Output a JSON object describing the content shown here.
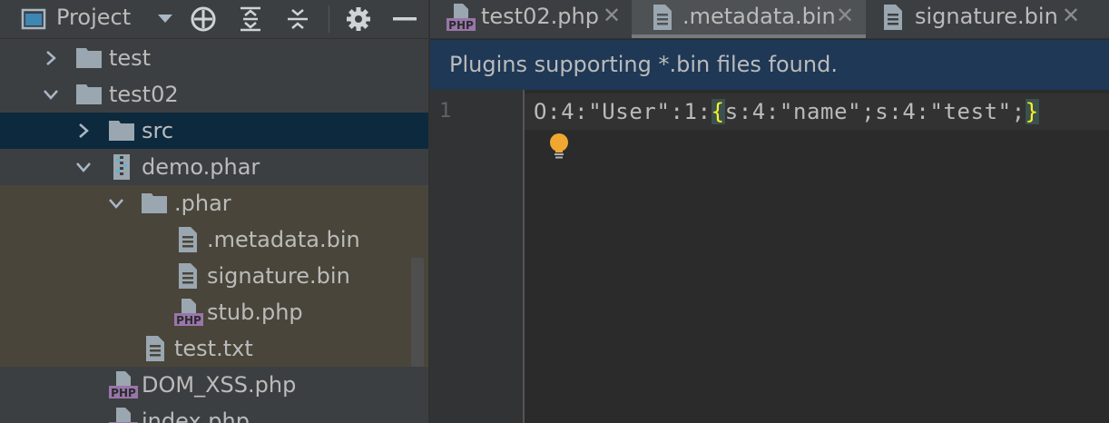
{
  "project_panel": {
    "title": "Project",
    "icons": [
      "window-icon",
      "dropdown-icon",
      "locate-icon",
      "expand-all-icon",
      "collapse-all-icon",
      "settings-icon",
      "minimize-icon"
    ],
    "tree": [
      {
        "label": "test",
        "type": "folder",
        "expanded": false
      },
      {
        "label": "test02",
        "type": "folder",
        "expanded": true
      },
      {
        "label": "src",
        "type": "folder",
        "expanded": false,
        "selected": true
      },
      {
        "label": "demo.phar",
        "type": "archive",
        "expanded": true
      },
      {
        "label": ".phar",
        "type": "folder",
        "expanded": true
      },
      {
        "label": ".metadata.bin",
        "type": "file"
      },
      {
        "label": "signature.bin",
        "type": "file"
      },
      {
        "label": "stub.php",
        "type": "php"
      },
      {
        "label": "test.txt",
        "type": "file"
      },
      {
        "label": "DOM_XSS.php",
        "type": "php"
      },
      {
        "label": "index.php",
        "type": "php"
      }
    ]
  },
  "editor": {
    "tabs": [
      {
        "label": "test02.php",
        "icon": "php-file-icon",
        "active": false
      },
      {
        "label": ".metadata.bin",
        "icon": "text-file-icon",
        "active": true
      },
      {
        "label": "signature.bin",
        "icon": "text-file-icon",
        "active": false
      }
    ],
    "notice": "Plugins supporting *.bin files found.",
    "line_number": "1",
    "code": {
      "before": "O:4:\"User\":1:",
      "open_brace": "{",
      "middle": "s:4:\"name\";s:4:\"test\";",
      "close_brace": "}"
    }
  },
  "colors": {
    "panel_bg": "#3c3f41",
    "editor_bg": "#2b2b2b",
    "selection": "#0d293e",
    "notice_bg": "#1f3855",
    "brace_match": "#ffef28",
    "php_icon": "#9876aa"
  }
}
